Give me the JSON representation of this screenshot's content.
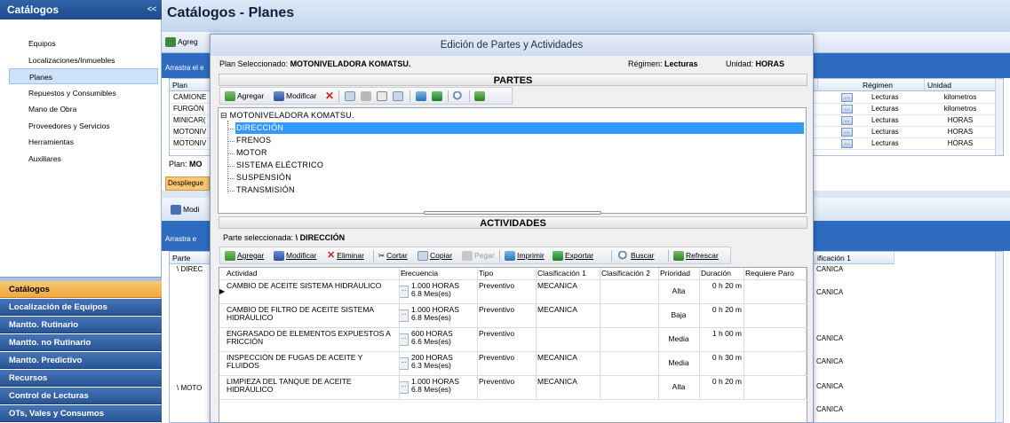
{
  "sidebar": {
    "title": "Catálogos",
    "collapse": "<<",
    "items": [
      "Equipos",
      "Localizaciones/Inmuebles",
      "Planes",
      "Repuestos y Consumibles",
      "Mano de Obra",
      "Proveedores y Servicios",
      "Herramientas",
      "Auxiliares"
    ],
    "selected_index": 2,
    "grip": "::::::::::",
    "sections": [
      "Catálogos",
      "Localización de Equipos",
      "Mantto. Rutinario",
      "Mantto. no Rutinario",
      "Mantto. Predictivo",
      "Recursos",
      "Control de Lecturas",
      "OTs, Vales y Consumos"
    ],
    "active_section_index": 0
  },
  "main": {
    "title": "Catálogos - Planes",
    "toolbar_add": "Agreg",
    "drag_hint": "Arrastra el e",
    "drag_hint2": "Arrastra e",
    "plans_grid": {
      "col_plan": "Plan",
      "col_regimen": "Régimen",
      "col_unidad": "Unidad",
      "rows": [
        {
          "plan": "CAMIONE",
          "regimen": "Lecturas",
          "unidad": "kilometros"
        },
        {
          "plan": "FURGÓN",
          "regimen": "Lecturas",
          "unidad": "kilometros"
        },
        {
          "plan": "MINICAR(",
          "regimen": "Lecturas",
          "unidad": "HORAS"
        },
        {
          "plan": "MOTONIV",
          "regimen": "Lecturas",
          "unidad": "HORAS"
        },
        {
          "plan": "MOTONIV",
          "regimen": "Lecturas",
          "unidad": "HORAS"
        }
      ]
    },
    "plan_label": "Plan: ",
    "plan_value": "MO",
    "despliegue": "Despliegue",
    "modify": "Modi",
    "parte_col": "Parte",
    "parte_rows": [
      "\\ DIREC",
      "\\ MOTO"
    ],
    "clasif_col": "ificación 1",
    "clasif_rows": [
      "CANICA",
      "CANICA",
      "",
      "CANICA",
      "CANICA",
      "CANICA",
      "CANICA"
    ]
  },
  "dialog": {
    "title": "Edición de Partes y Actividades",
    "plan_label": "Plan Seleccionado: ",
    "plan_value": "MOTONIVELADORA KOMATSU.",
    "regimen_label": "Régimen: ",
    "regimen_value": "Lecturas",
    "unidad_label": "Unidad: ",
    "unidad_value": "HORAS",
    "partes_header": "PARTES",
    "partes_toolbar": {
      "add": "Agregar",
      "modify": "Modificar"
    },
    "tree": {
      "root": "MOTONIVELADORA KOMATSU.",
      "children": [
        "DIRECCIÓN",
        "FRENOS",
        "MOTOR",
        "SISTEMA ELÉCTRICO",
        "SUSPENSIÓN",
        "TRANSMISIÓN"
      ],
      "selected_index": 0
    },
    "actividades_header": "ACTIVIDADES",
    "parte_sel_label": "Parte seleccionada: ",
    "parte_sel_value": "\\ DIRECCIÓN",
    "act_toolbar": {
      "add": "Agregar",
      "modify": "Modificar",
      "delete": "Eliminar",
      "cut": "Cortar",
      "copy": "Copiar",
      "paste": "Pegar",
      "print": "Imprimir",
      "export": "Exportar",
      "search": "Buscar",
      "refresh": "Refrescar"
    },
    "act_columns": [
      "Actividad",
      "Frecuencia",
      "Tipo",
      "Clasificación 1",
      "Clasificación 2",
      "Prioridad",
      "Duración",
      "Requiere Paro"
    ],
    "act_rows": [
      {
        "actividad": "CAMBIO DE ACEITE SISTEMA HIDRÁULICO",
        "f1": "1.000 HORAS",
        "f2": "6.8 Mes(es)",
        "tipo": "Preventivo",
        "clas1": "MECANICA",
        "clas2": "",
        "prioridad": "Alta",
        "duracion": "0 h 20 m"
      },
      {
        "actividad": "CAMBIO DE FILTRO DE ACEITE SISTEMA HIDRÁULICO",
        "f1": "1.000 HORAS",
        "f2": "6.8 Mes(es)",
        "tipo": "Preventivo",
        "clas1": "MECANICA",
        "clas2": "",
        "prioridad": "Baja",
        "duracion": "0 h 20 m"
      },
      {
        "actividad": "ENGRASADO DE ELEMENTOS EXPUESTOS A FRICCIÓN",
        "f1": "600 HORAS",
        "f2": "6.6 Mes(es)",
        "tipo": "Preventivo",
        "clas1": "",
        "clas2": "",
        "prioridad": "Media",
        "duracion": "1 h 00 m"
      },
      {
        "actividad": "INSPECCIÓN DE FUGAS DE ACEITE Y FLUIDOS",
        "f1": "200 HORAS",
        "f2": "6.3 Mes(es)",
        "tipo": "Preventivo",
        "clas1": "MECANICA",
        "clas2": "",
        "prioridad": "Media",
        "duracion": "0 h 30 m"
      },
      {
        "actividad": "LIMPIEZA DEL TANQUE DE ACEITE HIDRÁULICO",
        "f1": "1.000 HORAS",
        "f2": "6.8 Mes(es)",
        "tipo": "Preventivo",
        "clas1": "MECANICA",
        "clas2": "",
        "prioridad": "Alta",
        "duracion": "0 h 20 m"
      }
    ]
  }
}
